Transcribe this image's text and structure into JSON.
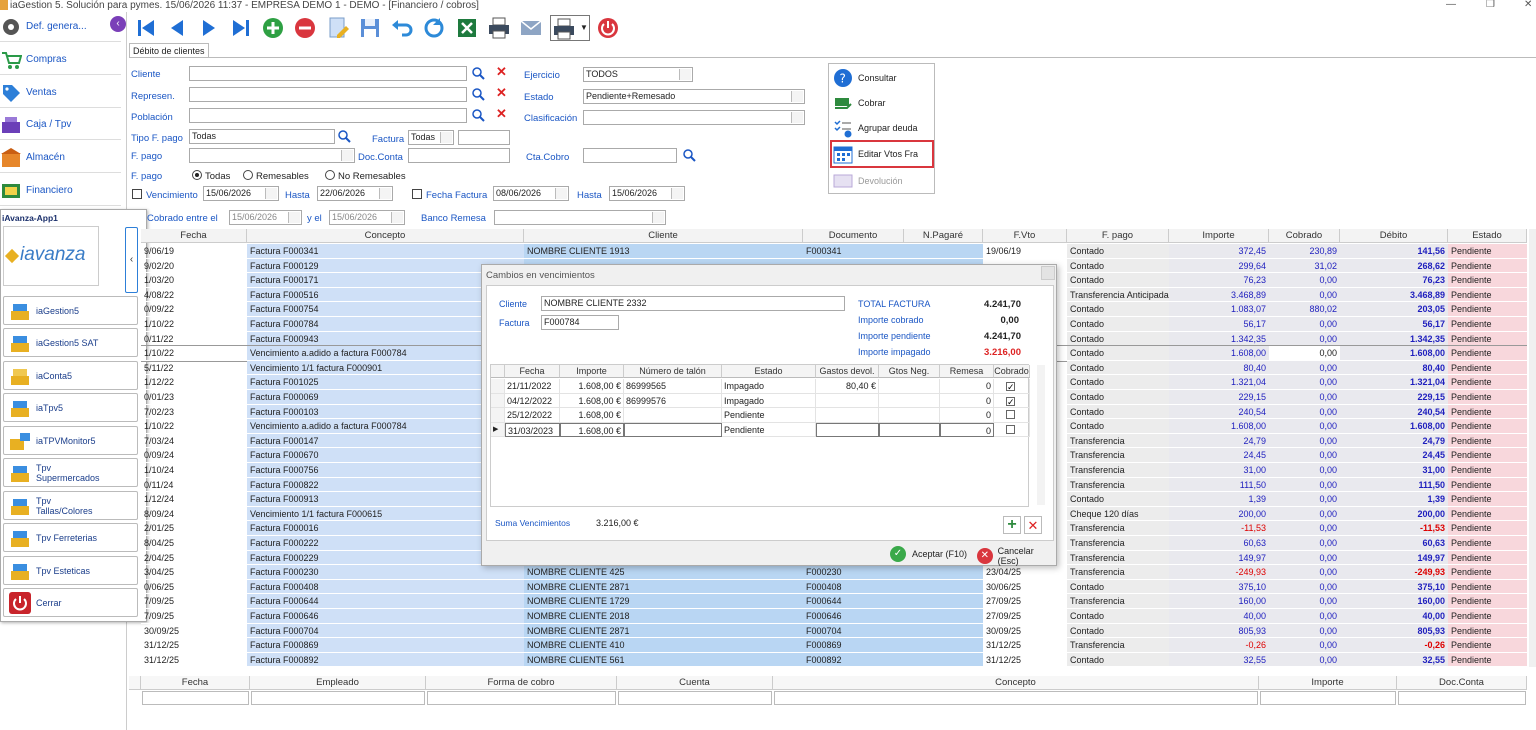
{
  "window": {
    "title": "iaGestion 5. Solución para pymes.   15/06/2026 11:37   -   EMPRESA DEMO 1 - DEMO - [Financiero / cobros]"
  },
  "sidebar": {
    "items": [
      {
        "label": "Def. genera...",
        "icon": "gear-icon"
      },
      {
        "label": "Compras",
        "icon": "cart-icon"
      },
      {
        "label": "Ventas",
        "icon": "tag-icon"
      },
      {
        "label": "Caja / Tpv",
        "icon": "cash-register-icon"
      },
      {
        "label": "Almacén",
        "icon": "warehouse-icon"
      },
      {
        "label": "Financiero",
        "icon": "money-icon"
      }
    ],
    "app_panel_title": "iAvanza-App1",
    "logo_text": "iavanza",
    "apps": [
      {
        "label": "iaGestion5"
      },
      {
        "label": "iaGestion5 SAT"
      },
      {
        "label": "iaConta5"
      },
      {
        "label": "iaTpv5"
      },
      {
        "label": "iaTPVMonitor5"
      },
      {
        "label": "Tpv\nSupermercados",
        "l1": "Tpv",
        "l2": "Supermercados"
      },
      {
        "label": "Tpv\nTallas/Colores",
        "l1": "Tpv",
        "l2": "Tallas/Colores"
      },
      {
        "label": "Tpv Ferreterias"
      },
      {
        "label": "Tpv Esteticas"
      },
      {
        "label": "Cerrar"
      }
    ]
  },
  "tab": {
    "label": "Débito de clientes"
  },
  "filters": {
    "cliente_label": "Cliente",
    "represen_label": "Represen.",
    "poblacion_label": "Población",
    "tipo_fpago_label": "Tipo F. pago",
    "tipo_fpago_value": "Todas",
    "factura_label": "Factura",
    "factura_value": "Todas",
    "fpago_label": "F. pago",
    "docconta_label": "Doc.Conta",
    "fpago_radio_label": "F. pago",
    "radio_todas": "Todas",
    "radio_remesables": "Remesables",
    "radio_noremesables": "No Remesables",
    "vencimiento_label": "Vencimiento",
    "venc_from": "15/06/2026",
    "hasta1_label": "Hasta",
    "venc_to": "22/06/2026",
    "fecha_factura_label": "Fecha Factura",
    "ff_from": "08/06/2026",
    "hasta2_label": "Hasta",
    "ff_to": "15/06/2026",
    "cobrado_label": "Cobrado entre el",
    "cobrado_from": "15/06/2026",
    "y_el_label": "y el",
    "cobrado_to": "15/06/2026",
    "banco_remesa_label": "Banco Remesa",
    "ejercicio_label": "Ejercicio",
    "ejercicio_value": "TODOS",
    "estado_label": "Estado",
    "estado_value": "Pendiente+Remesado",
    "clasificacion_label": "Clasificación",
    "ctacobro_label": "Cta.Cobro"
  },
  "actions": {
    "consultar": "Consultar",
    "cobrar": "Cobrar",
    "agrupar": "Agrupar deuda",
    "editar": "Editar Vtos Fra",
    "devolucion": "Devolución"
  },
  "grid": {
    "headers": [
      "Fecha",
      "Concepto",
      "Cliente",
      "Documento",
      "N.Pagaré",
      "F.Vto",
      "F. pago",
      "Importe",
      "Cobrado",
      "Débito",
      "Estado"
    ],
    "rows": [
      [
        "9/06/19",
        "Factura F000341",
        "NOMBRE CLIENTE 1913",
        "F000341",
        "",
        "19/06/19",
        "Contado",
        "372,45",
        "230,89",
        "141,56",
        "Pendiente"
      ],
      [
        "9/02/20",
        "Factura F000129",
        "",
        "",
        "",
        "",
        "Contado",
        "299,64",
        "31,02",
        "268,62",
        "Pendiente"
      ],
      [
        "1/03/20",
        "Factura F000171",
        "",
        "",
        "",
        "",
        "Contado",
        "76,23",
        "0,00",
        "76,23",
        "Pendiente"
      ],
      [
        "4/08/22",
        "Factura F000516",
        "",
        "",
        "",
        "",
        "Transferencia Anticipada",
        "3.468,89",
        "0,00",
        "3.468,89",
        "Pendiente"
      ],
      [
        "0/09/22",
        "Factura F000754",
        "",
        "",
        "",
        "",
        "Contado",
        "1.083,07",
        "880,02",
        "203,05",
        "Pendiente"
      ],
      [
        "1/10/22",
        "Factura F000784",
        "",
        "",
        "",
        "",
        "Contado",
        "56,17",
        "0,00",
        "56,17",
        "Pendiente"
      ],
      [
        "0/11/22",
        "Factura F000943",
        "",
        "",
        "",
        "",
        "Contado",
        "1.342,35",
        "0,00",
        "1.342,35",
        "Pendiente"
      ],
      [
        "1/10/22",
        "Vencimiento a.adido a factura F000784",
        "",
        "",
        "",
        "",
        "Contado",
        "1.608,00",
        "0,00",
        "1.608,00",
        "Pendiente"
      ],
      [
        "5/11/22",
        "Vencimiento 1/1 factura F000901",
        "",
        "",
        "",
        "",
        "Contado",
        "80,40",
        "0,00",
        "80,40",
        "Pendiente"
      ],
      [
        "1/12/22",
        "Factura F001025",
        "",
        "",
        "",
        "",
        "Contado",
        "1.321,04",
        "0,00",
        "1.321,04",
        "Pendiente"
      ],
      [
        "0/01/23",
        "Factura F000069",
        "",
        "",
        "",
        "",
        "Contado",
        "229,15",
        "0,00",
        "229,15",
        "Pendiente"
      ],
      [
        "7/02/23",
        "Factura F000103",
        "",
        "",
        "",
        "",
        "Contado",
        "240,54",
        "0,00",
        "240,54",
        "Pendiente"
      ],
      [
        "1/10/22",
        "Vencimiento a.adido a factura F000784",
        "",
        "",
        "",
        "",
        "Contado",
        "1.608,00",
        "0,00",
        "1.608,00",
        "Pendiente"
      ],
      [
        "7/03/24",
        "Factura F000147",
        "",
        "",
        "",
        "",
        "Transferencia",
        "24,79",
        "0,00",
        "24,79",
        "Pendiente"
      ],
      [
        "0/09/24",
        "Factura F000670",
        "",
        "",
        "",
        "",
        "Transferencia",
        "24,45",
        "0,00",
        "24,45",
        "Pendiente"
      ],
      [
        "1/10/24",
        "Factura F000756",
        "",
        "",
        "",
        "",
        "Transferencia",
        "31,00",
        "0,00",
        "31,00",
        "Pendiente"
      ],
      [
        "0/11/24",
        "Factura F000822",
        "",
        "",
        "",
        "",
        "Transferencia",
        "111,50",
        "0,00",
        "111,50",
        "Pendiente"
      ],
      [
        "1/12/24",
        "Factura F000913",
        "",
        "",
        "",
        "",
        "Contado",
        "1,39",
        "0,00",
        "1,39",
        "Pendiente"
      ],
      [
        "8/09/24",
        "Vencimiento 1/1 factura F000615",
        "",
        "",
        "",
        "",
        "Cheque 120 días",
        "200,00",
        "0,00",
        "200,00",
        "Pendiente"
      ],
      [
        "2/01/25",
        "Factura F000016",
        "",
        "",
        "",
        "",
        "Transferencia",
        "-11,53",
        "0,00",
        "-11,53",
        "Pendiente"
      ],
      [
        "8/04/25",
        "Factura F000222",
        "",
        "",
        "",
        "",
        "Transferencia",
        "60,63",
        "0,00",
        "60,63",
        "Pendiente"
      ],
      [
        "2/04/25",
        "Factura F000229",
        "",
        "",
        "",
        "",
        "Transferencia",
        "149,97",
        "0,00",
        "149,97",
        "Pendiente"
      ],
      [
        "3/04/25",
        "Factura F000230",
        "NOMBRE CLIENTE 425",
        "F000230",
        "",
        "23/04/25",
        "Transferencia",
        "-249,93",
        "0,00",
        "-249,93",
        "Pendiente"
      ],
      [
        "0/06/25",
        "Factura F000408",
        "NOMBRE CLIENTE 2871",
        "F000408",
        "",
        "30/06/25",
        "Contado",
        "375,10",
        "0,00",
        "375,10",
        "Pendiente"
      ],
      [
        "7/09/25",
        "Factura F000644",
        "NOMBRE CLIENTE 1729",
        "F000644",
        "",
        "27/09/25",
        "Transferencia",
        "160,00",
        "0,00",
        "160,00",
        "Pendiente"
      ],
      [
        "7/09/25",
        "Factura F000646",
        "NOMBRE CLIENTE 2018",
        "F000646",
        "",
        "27/09/25",
        "Contado",
        "40,00",
        "0,00",
        "40,00",
        "Pendiente"
      ],
      [
        "30/09/25",
        "Factura F000704",
        "NOMBRE CLIENTE 2871",
        "F000704",
        "",
        "30/09/25",
        "Contado",
        "805,93",
        "0,00",
        "805,93",
        "Pendiente"
      ],
      [
        "31/12/25",
        "Factura F000869",
        "NOMBRE CLIENTE 410",
        "F000869",
        "",
        "31/12/25",
        "Transferencia",
        "-0,26",
        "0,00",
        "-0,26",
        "Pendiente"
      ],
      [
        "31/12/25",
        "Factura F000892",
        "NOMBRE CLIENTE 561",
        "F000892",
        "",
        "31/12/25",
        "Contado",
        "32,55",
        "0,00",
        "32,55",
        "Pendiente"
      ]
    ]
  },
  "modal": {
    "title": "Cambios en vencimientos",
    "cliente_label": "Cliente",
    "cliente_value": "NOMBRE CLIENTE 2332",
    "factura_label": "Factura",
    "factura_value": "F000784",
    "total_factura_label": "TOTAL FACTURA",
    "total_factura_value": "4.241,70",
    "importe_cobrado_label": "Importe cobrado",
    "importe_cobrado_value": "0,00",
    "importe_pendiente_label": "Importe pendiente",
    "importe_pendiente_value": "4.241,70",
    "importe_impagado_label": "Importe impagado",
    "importe_impagado_value": "3.216,00",
    "headers": [
      "Fecha",
      "Importe",
      "Número de talón",
      "Estado",
      "Gastos devol.",
      "Gtos Neg.",
      "Remesa",
      "Cobrado"
    ],
    "rows": [
      {
        "fecha": "21/11/2022",
        "importe": "1.608,00 €",
        "talon": "86999565",
        "estado": "Impagado",
        "gastos": "80,40 €",
        "gneg": "",
        "remesa": "0",
        "cobrado": true
      },
      {
        "fecha": "04/12/2022",
        "importe": "1.608,00 €",
        "talon": "86999576",
        "estado": "Impagado",
        "gastos": "",
        "gneg": "",
        "remesa": "0",
        "cobrado": true
      },
      {
        "fecha": "25/12/2022",
        "importe": "1.608,00 €",
        "talon": "",
        "estado": "Pendiente",
        "gastos": "",
        "gneg": "",
        "remesa": "0",
        "cobrado": false
      },
      {
        "fecha": "31/03/2023",
        "importe": "1.608,00 €",
        "talon": "",
        "estado": "Pendiente",
        "gastos": "",
        "gneg": "",
        "remesa": "0",
        "cobrado": false
      }
    ],
    "suma_label": "Suma Vencimientos",
    "suma_value": "3.216,00 €",
    "aceptar_label": "Aceptar (F10)",
    "cancelar_label": "Cancelar (Esc)"
  },
  "bottom_grid": {
    "headers": [
      "Fecha",
      "Empleado",
      "Forma de cobro",
      "Cuenta",
      "Concepto",
      "Importe",
      "Doc.Conta"
    ]
  },
  "colors": {
    "accent_blue": "#1a56c4",
    "selection_blue": "#cfe0f7",
    "client_blue": "#b9d6f3",
    "estado_pink": "#f8d7dc",
    "negative_red": "#d00000",
    "highlight_red": "#d9363e"
  }
}
